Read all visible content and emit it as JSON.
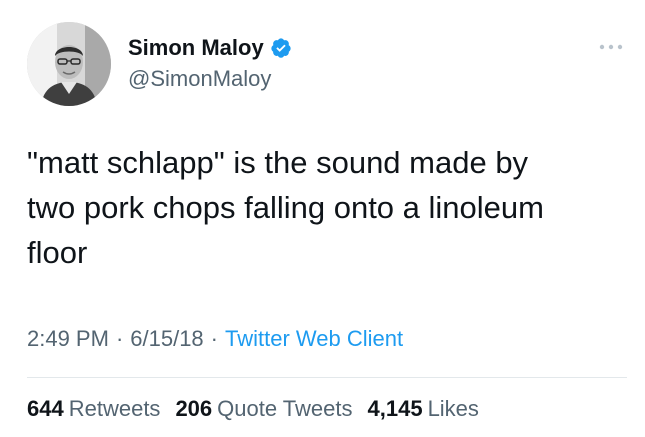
{
  "author": {
    "display_name": "Simon Maloy",
    "handle": "@SimonMaloy",
    "verified_icon": "verified-badge-icon",
    "avatar_icon": "avatar-photo"
  },
  "tweet": {
    "text": "\"matt schlapp\" is the sound made by\ntwo pork chops falling onto a linoleum\nfloor"
  },
  "meta": {
    "time": "2:49 PM",
    "separator": "·",
    "date": "6/15/18",
    "client": "Twitter Web Client"
  },
  "stats": {
    "retweets_count": "644",
    "retweets_label": "Retweets",
    "quote_count": "206",
    "quote_label": "Quote Tweets",
    "likes_count": "4,145",
    "likes_label": "Likes"
  },
  "colors": {
    "primary_text": "#0f1419",
    "secondary_text": "#536471",
    "accent": "#1d9bf0",
    "divider": "#e3e8eb"
  }
}
